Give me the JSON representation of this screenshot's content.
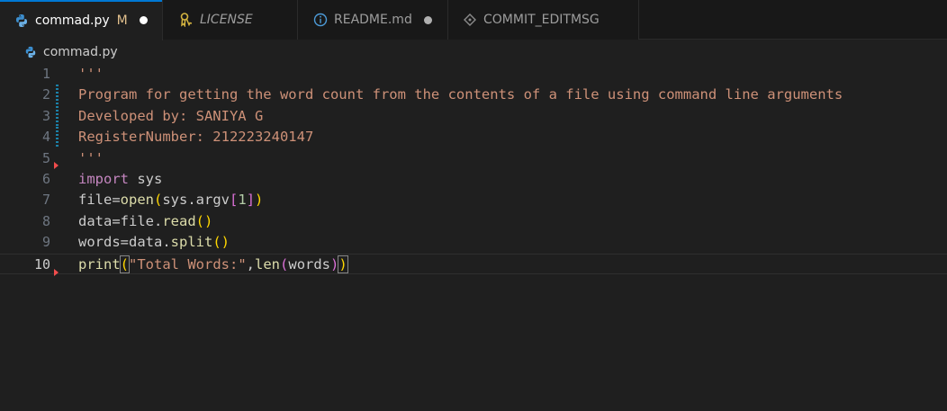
{
  "tabs": [
    {
      "label": "commad.py",
      "modified": "M",
      "icon": "python-icon"
    },
    {
      "label": "LICENSE",
      "icon": "license-icon"
    },
    {
      "label": "README.md",
      "icon": "info-icon"
    },
    {
      "label": "COMMIT_EDITMSG",
      "icon": "git-commit-icon"
    }
  ],
  "breadcrumb": {
    "file": "commad.py"
  },
  "editor": {
    "line_numbers": [
      "1",
      "2",
      "3",
      "4",
      "5",
      "6",
      "7",
      "8",
      "9",
      "10"
    ],
    "lines": [
      {
        "t1": "'''"
      },
      {
        "t1": "Program for getting the word count from the contents of a file using command line arguments"
      },
      {
        "t1": "Developed by: SANIYA G"
      },
      {
        "t1": "RegisterNumber: 212223240147"
      },
      {
        "t1": "'''"
      },
      {
        "t1": "import",
        "t2": " sys"
      },
      {
        "t1": "file=",
        "t2": "open",
        "t3": "(",
        "t4": "sys.argv",
        "t5": "[",
        "t6": "1",
        "t7": "]",
        "t8": ")"
      },
      {
        "t1": "data=file.",
        "t2": "read",
        "t3": "()"
      },
      {
        "t1": "words=data.",
        "t2": "split",
        "t3": "()"
      },
      {
        "t1": "print",
        "t2": "(",
        "t3": "\"Total Words:\"",
        "t4": ",",
        "t5": "len",
        "t6": "(",
        "t7": "words",
        "t8": ")",
        "t9": ")"
      }
    ]
  },
  "colors": {
    "active_tab_border": "#0078d4",
    "string": "#ce9178",
    "keyword": "#c586c0",
    "function": "#dcdcaa",
    "bracket1": "#ffd700",
    "bracket2": "#da70d6",
    "number": "#b5cea8"
  }
}
